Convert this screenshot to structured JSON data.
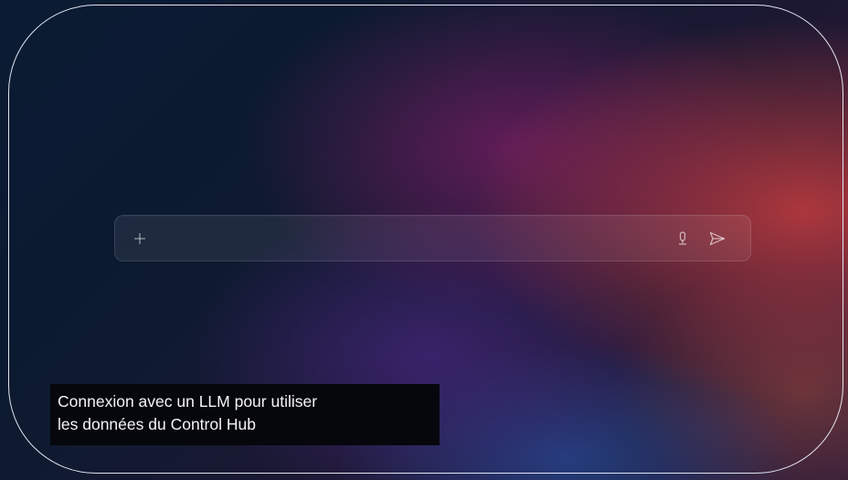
{
  "composer": {
    "input_value": "",
    "placeholder": "",
    "add_icon": "plus-icon",
    "mic_icon": "microphone-icon",
    "send_icon": "send-icon"
  },
  "caption": {
    "line1": "Connexion avec un LLM pour utiliser",
    "line2": "les données du Control Hub"
  },
  "colors": {
    "caption_background": "#05070c",
    "caption_text": "#f4f4f6",
    "frame_border": "#ebf0fa",
    "background_base": "#0a1b33",
    "background_accent_red": "#c43c3e",
    "background_accent_purple": "#781e64"
  }
}
